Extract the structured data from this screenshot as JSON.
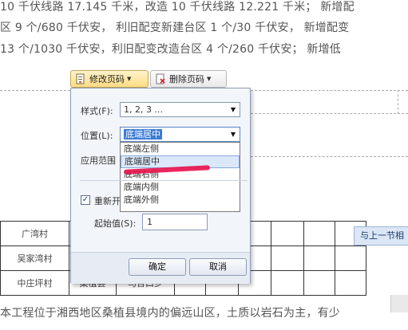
{
  "document": {
    "lines": [
      "10 千伏线路 17.145 千米，改造 10 千伏线路 12.221 千米；  新增配",
      "区 9 个/680 千伏安，  利旧配变新建台区 1 个/30 千伏安，  新增配变",
      "13 个/1030 千伏安，利旧配变改造台区 4 个/260 千伏安；  新增低",
      "本工程位于湘西地区桑植县境内的偏远山区，土质以岩石为主，有少"
    ],
    "table": {
      "rows": [
        [
          "广湾村",
          "",
          "",
          "",
          "",
          "",
          "",
          "",
          ""
        ],
        [
          "吴家湾村",
          "",
          "",
          "",
          "",
          "",
          "",
          "",
          ""
        ],
        [
          "中庄坪村",
          "桑植县",
          "马合口乡",
          "",
          "",
          "",
          "",
          "",
          ""
        ]
      ]
    },
    "prev_section_label": "与上一节相"
  },
  "toolbar": {
    "edit_label": "修改页码",
    "delete_label": "删除页码"
  },
  "dialog": {
    "style_label": "样式(F):",
    "style_value": "1, 2, 3 ...",
    "position_label": "位置(L):",
    "position_value": "底端居中",
    "position_options": [
      "底端左侧",
      "底端居中",
      "底端右侧",
      "底端内侧",
      "底端外侧"
    ],
    "apply_label": "应用范围",
    "restart_label": "重新开",
    "start_label": "起始值(S):",
    "start_value": "1",
    "ok_label": "确定",
    "cancel_label": "取消"
  },
  "colors": {
    "selection": "#3a7bd5",
    "highlight_stroke": "#e8164f",
    "dialog_bg": "#f2f5fa"
  }
}
